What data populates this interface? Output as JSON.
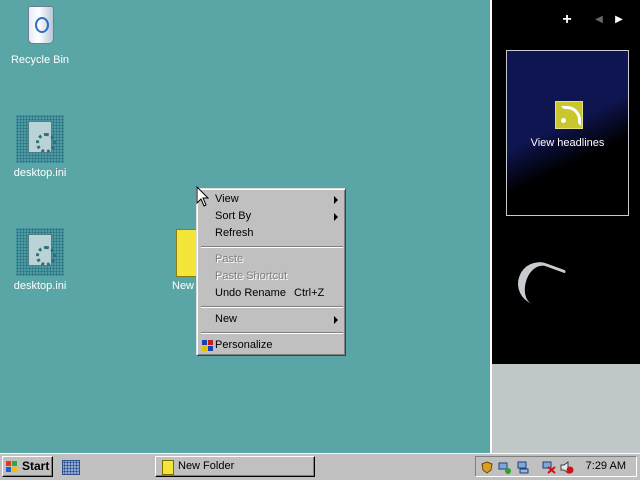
{
  "desktop": {
    "icons": [
      {
        "label": "Recycle Bin",
        "icon": "recycle-bin-icon"
      },
      {
        "label": "desktop.ini",
        "icon": "settings-file-icon"
      },
      {
        "label": "desktop.ini",
        "icon": "settings-file-icon"
      },
      {
        "label": "New",
        "icon": "folder-icon"
      }
    ]
  },
  "context_menu": {
    "items": [
      {
        "label": "View",
        "submenu": true,
        "enabled": true
      },
      {
        "label": "Sort By",
        "submenu": true,
        "enabled": true
      },
      {
        "label": "Refresh",
        "enabled": true
      },
      {
        "label": "Paste",
        "enabled": false
      },
      {
        "label": "Paste Shortcut",
        "enabled": false
      },
      {
        "label": "Undo Rename",
        "shortcut": "Ctrl+Z",
        "enabled": true
      },
      {
        "label": "New",
        "submenu": true,
        "enabled": true
      },
      {
        "label": "Personalize",
        "icon": "personalize-icon",
        "enabled": true
      }
    ]
  },
  "sidebar": {
    "add_label": "+",
    "prev_icon": "◀",
    "next_icon": "▶",
    "feed_tile": {
      "label": "View headlines",
      "icon": "rss-feed-icon"
    },
    "clock_gadget": {
      "icon": "clock-gadget-icon"
    }
  },
  "taskbar": {
    "start_label": "Start",
    "quick_launch_icon": "show-desktop-icon",
    "tasks": [
      {
        "label": "New Folder",
        "icon": "folder-icon"
      }
    ],
    "tray_icons": [
      "shield-icon",
      "network-icon",
      "network-icon",
      "network-disconnected-icon",
      "volume-muted-icon"
    ],
    "clock": "7:29 AM"
  },
  "colors": {
    "desktop": "#5aa5a5",
    "sidebar_bg": "#000000",
    "window_chrome": "#c0c0c0"
  }
}
